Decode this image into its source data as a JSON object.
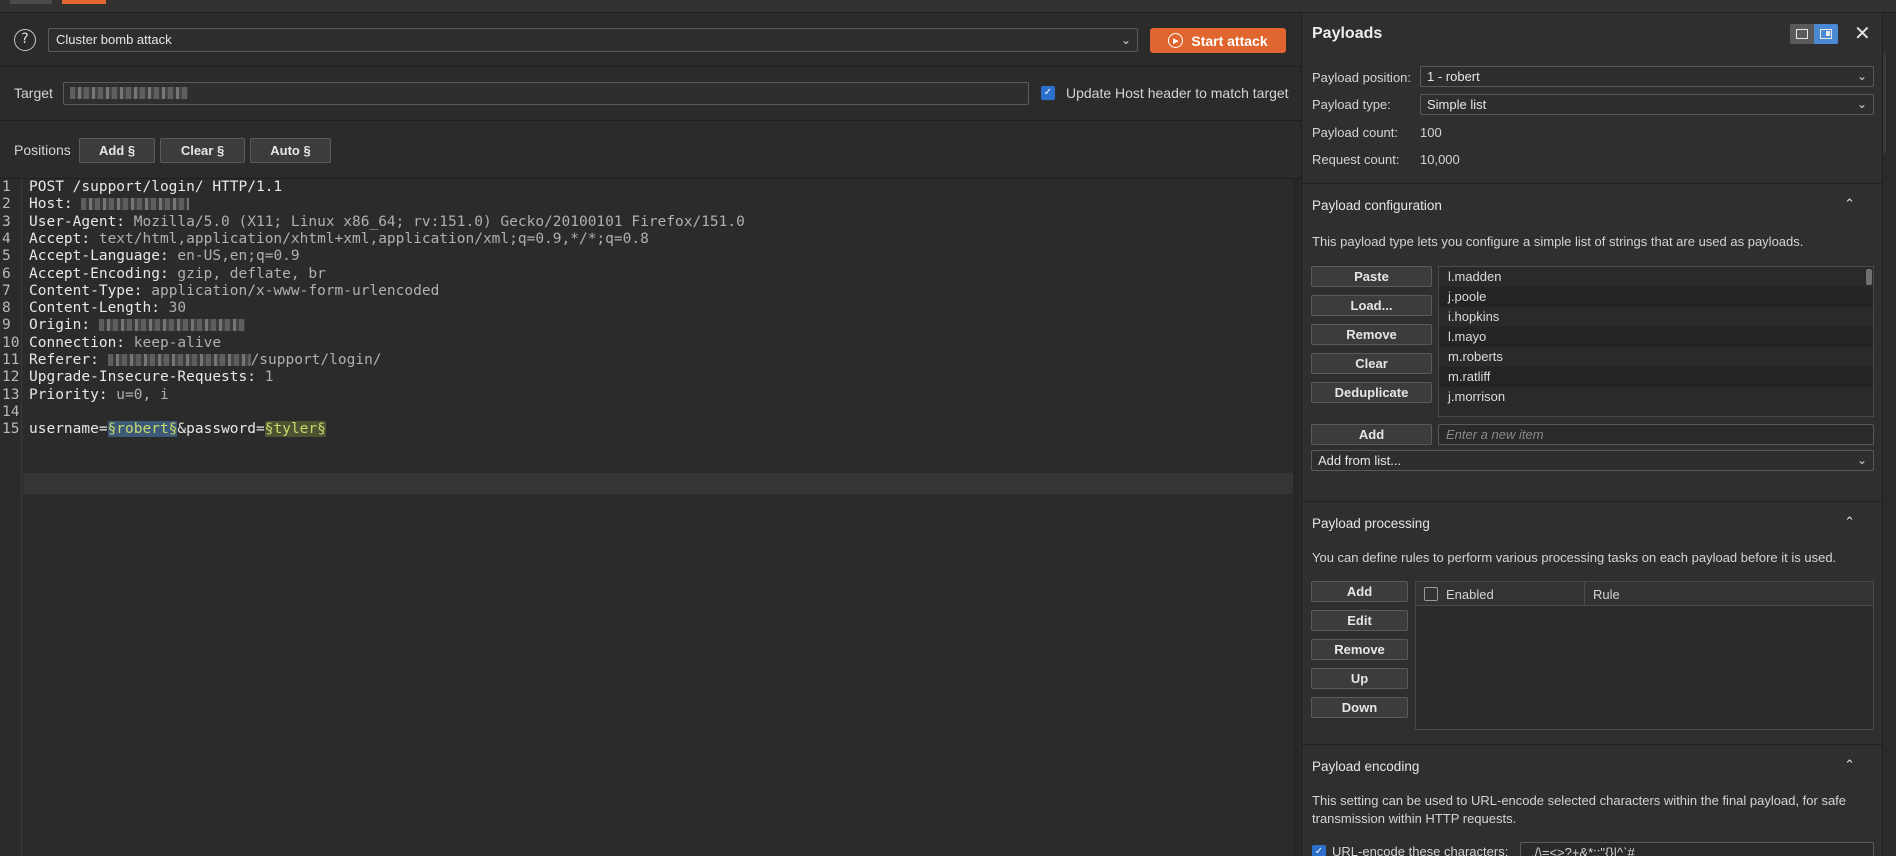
{
  "attack": {
    "type": "Cluster bomb attack",
    "start_label": "Start attack"
  },
  "target": {
    "label": "Target",
    "update_host_label": "Update Host header to match target"
  },
  "positions": {
    "label": "Positions",
    "add": "Add §",
    "clear": "Clear §",
    "auto": "Auto §"
  },
  "request": {
    "lines": [
      {
        "n": "1",
        "k": "POST /support/login/ HTTP/1.1",
        "v": ""
      },
      {
        "n": "2",
        "k": "Host:",
        "v": ""
      },
      {
        "n": "3",
        "k": "User-Agent:",
        "v": " Mozilla/5.0 (X11; Linux x86_64; rv:151.0) Gecko/20100101 Firefox/151.0"
      },
      {
        "n": "4",
        "k": "Accept:",
        "v": " text/html,application/xhtml+xml,application/xml;q=0.9,*/*;q=0.8"
      },
      {
        "n": "5",
        "k": "Accept-Language:",
        "v": " en-US,en;q=0.9"
      },
      {
        "n": "6",
        "k": "Accept-Encoding:",
        "v": " gzip, deflate, br"
      },
      {
        "n": "7",
        "k": "Content-Type:",
        "v": " application/x-www-form-urlencoded"
      },
      {
        "n": "8",
        "k": "Content-Length:",
        "v": " 30"
      },
      {
        "n": "9",
        "k": "Origin:",
        "v": ""
      },
      {
        "n": "10",
        "k": "Connection:",
        "v": " keep-alive"
      },
      {
        "n": "11",
        "k": "Referer:",
        "v": ""
      },
      {
        "n": "12",
        "k": "Upgrade-Insecure-Requests:",
        "v": " 1"
      },
      {
        "n": "13",
        "k": "Priority:",
        "v": " u=0, i"
      },
      {
        "n": "14",
        "k": "",
        "v": ""
      },
      {
        "n": "15",
        "k": "",
        "v": ""
      }
    ],
    "referer_suffix": "/support/login/",
    "body_prefix": "username=",
    "marker1": "§robert§",
    "body_mid": "&password=",
    "marker2": "§tyler§"
  },
  "payloads": {
    "title": "Payloads",
    "position_label": "Payload position:",
    "position_value": "1 - robert",
    "type_label": "Payload type:",
    "type_value": "Simple list",
    "count_label": "Payload count:",
    "count_value": "100",
    "request_count_label": "Request count:",
    "request_count_value": "10,000"
  },
  "config": {
    "title": "Payload configuration",
    "desc": "This payload type lets you configure a simple list of strings that are used as payloads.",
    "buttons": {
      "paste": "Paste",
      "load": "Load...",
      "remove": "Remove",
      "clear": "Clear",
      "dedup": "Deduplicate",
      "add": "Add"
    },
    "items": [
      "l.madden",
      "j.poole",
      "i.hopkins",
      "l.mayo",
      "m.roberts",
      "m.ratliff",
      "j.morrison"
    ],
    "new_item_placeholder": "Enter a new item",
    "add_from_list": "Add from list..."
  },
  "processing": {
    "title": "Payload processing",
    "desc": "You can define rules to perform various processing tasks on each payload before it is used.",
    "buttons": {
      "add": "Add",
      "edit": "Edit",
      "remove": "Remove",
      "up": "Up",
      "down": "Down"
    },
    "col_enabled": "Enabled",
    "col_rule": "Rule"
  },
  "encoding": {
    "title": "Payload encoding",
    "desc": "This setting can be used to URL-encode selected characters within the final payload, for safe transmission within HTTP requests.",
    "check_label": "URL-encode these characters:",
    "chars": "./\\=<>?+&*;:\"{}|^`#"
  }
}
